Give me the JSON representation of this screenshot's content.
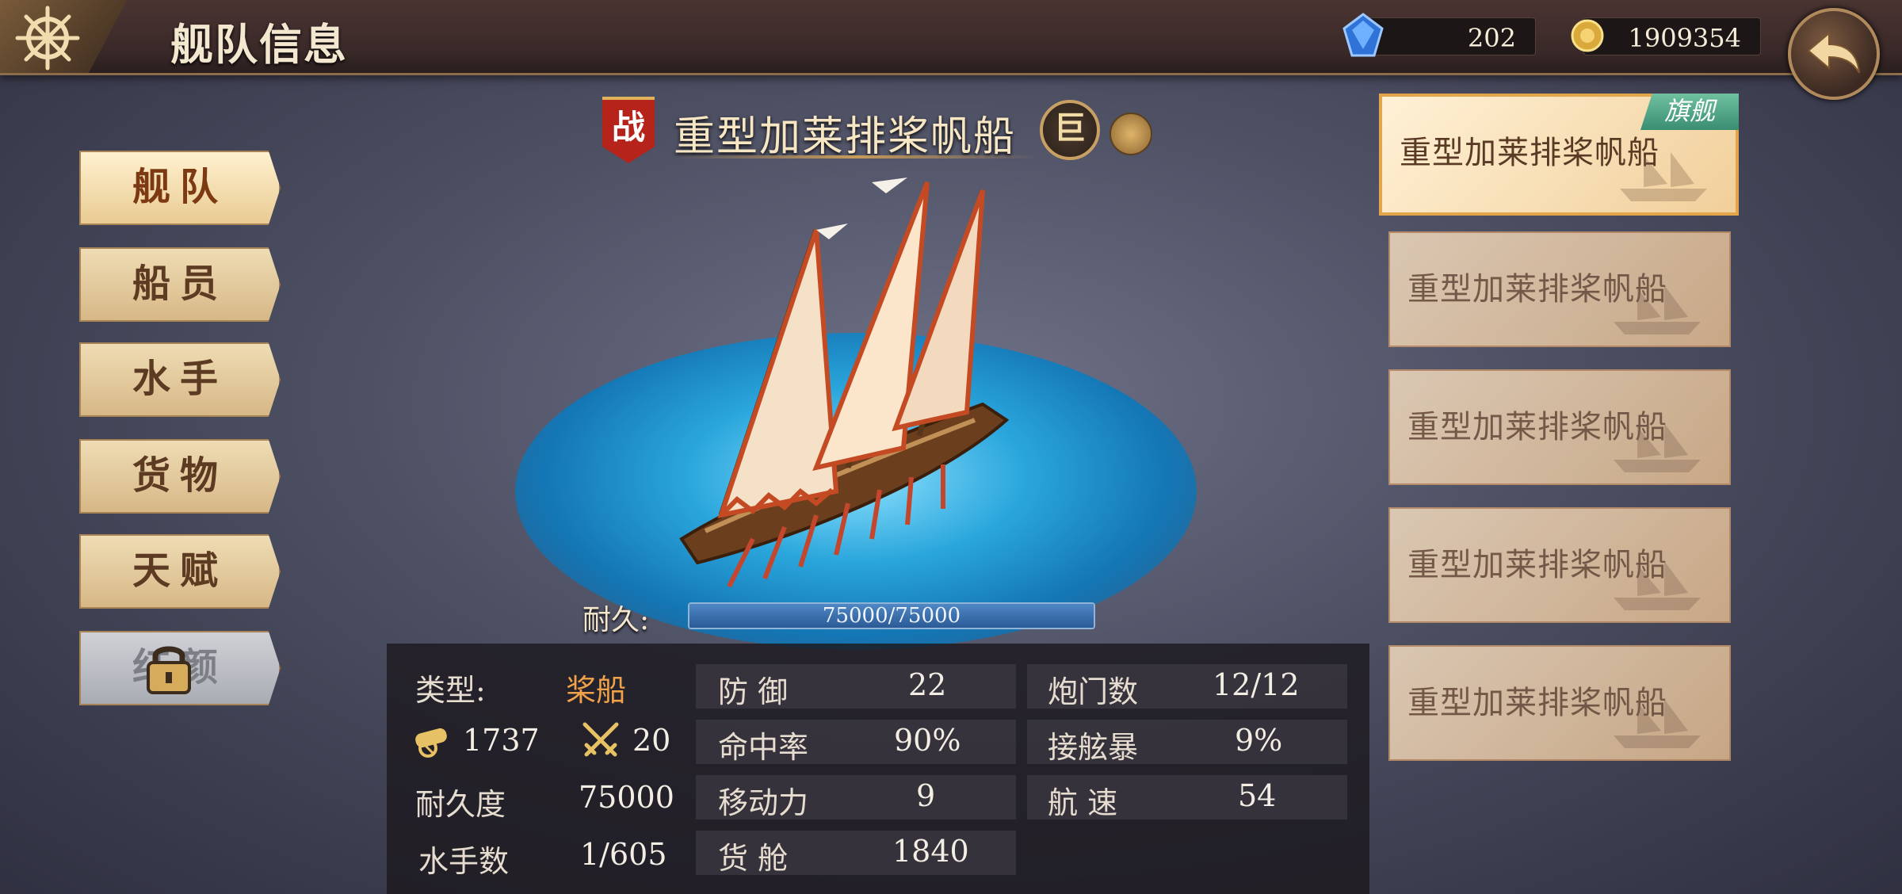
{
  "header": {
    "title": "舰队信息",
    "gems": "202",
    "gold": "1909354"
  },
  "menu": [
    {
      "label": "舰队"
    },
    {
      "label": "船员"
    },
    {
      "label": "水手"
    },
    {
      "label": "货物"
    },
    {
      "label": "天赋"
    },
    {
      "label": "红颜"
    }
  ],
  "ship": {
    "battle_tag": "战",
    "name": "重型加莱排桨帆船",
    "size_badge": "巨",
    "durability_label": "耐久:",
    "durability_text": "75000/75000",
    "durability_fraction": 1.0
  },
  "stats": {
    "type_label": "类型:",
    "type_value": "桨船",
    "cannon_value": "1737",
    "melee_value": "20",
    "durability_label": "耐久度",
    "durability_value": "75000",
    "sailors_label": "水手数",
    "sailors_value": "1/605",
    "defense_label": "防 御",
    "defense_value": "22",
    "hit_label": "命中率",
    "hit_value": "90%",
    "move_label": "移动力",
    "move_value": "9",
    "cargo_label": "货 舱",
    "cargo_value": "1840",
    "gunports_label": "炮门数",
    "gunports_value": "12/12",
    "boarding_label": "接舷暴",
    "boarding_value": "9%",
    "speed_label": "航 速",
    "speed_value": "54"
  },
  "fleet": {
    "flagship_tag": "旗舰",
    "ships": [
      {
        "name": "重型加莱排桨帆船"
      },
      {
        "name": "重型加莱排桨帆船"
      },
      {
        "name": "重型加莱排桨帆船"
      },
      {
        "name": "重型加莱排桨帆船"
      },
      {
        "name": "重型加莱排桨帆船"
      }
    ]
  },
  "icons": [
    "ship-wheel-icon",
    "gem-icon",
    "gold-coin-icon",
    "back-arrow-icon",
    "lock-icon",
    "refresh-icon",
    "cannon-icon",
    "crossed-swords-icon"
  ]
}
